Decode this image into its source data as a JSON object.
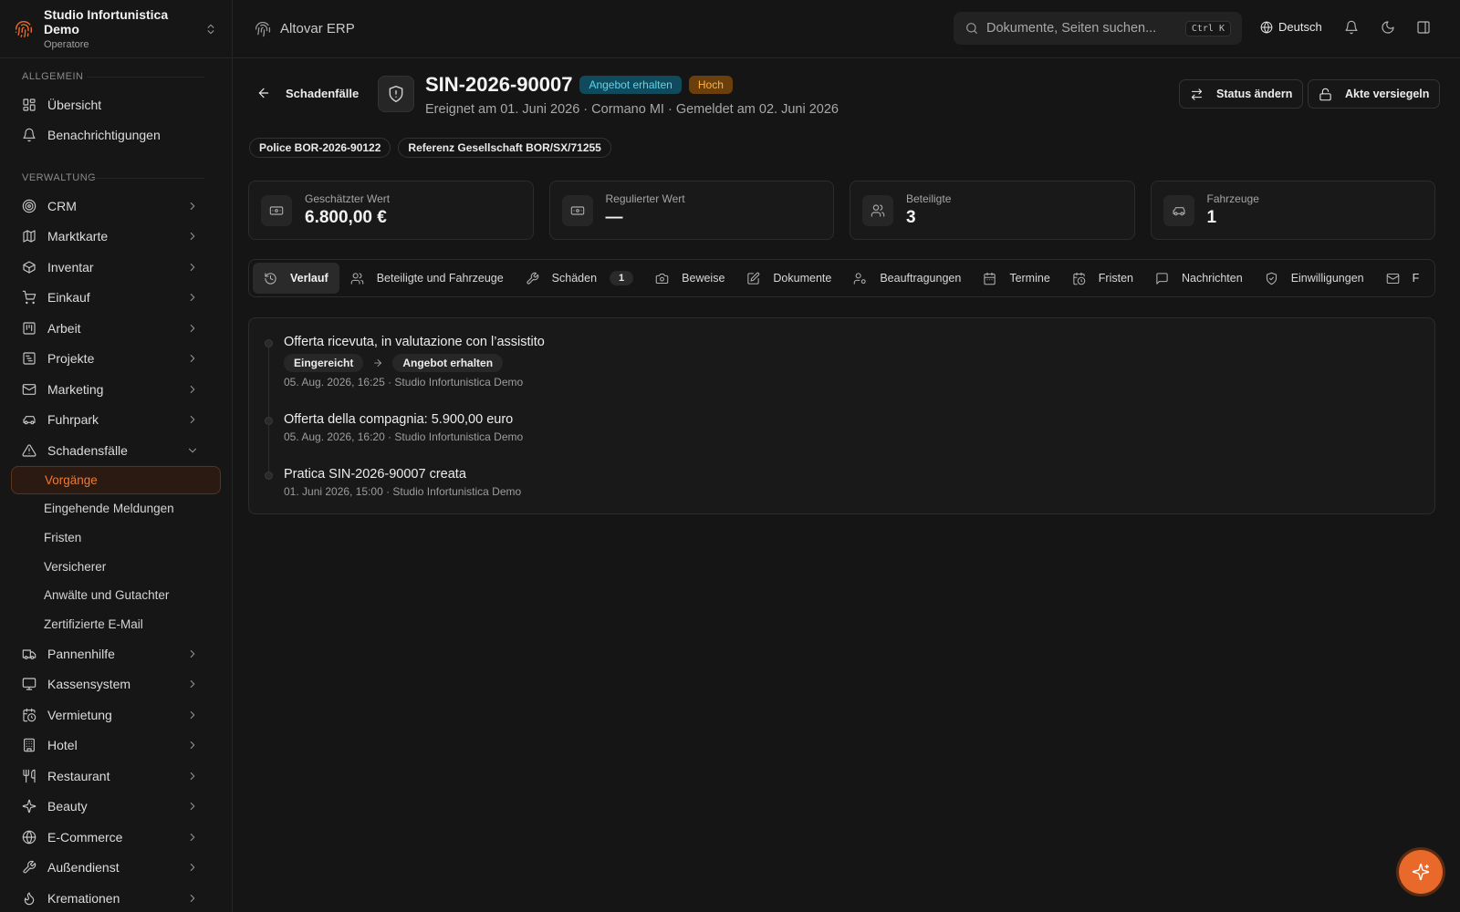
{
  "org": {
    "name": "Studio Infortunistica Demo",
    "role": "Operatore"
  },
  "sidebar": {
    "sections": [
      {
        "label": "Allgemein"
      },
      {
        "label": "Verwaltung"
      }
    ],
    "general": [
      {
        "label": "Übersicht",
        "icon": "dashboard-icon"
      },
      {
        "label": "Benachrichtigungen",
        "icon": "bell-icon"
      }
    ],
    "admin": [
      {
        "label": "CRM",
        "icon": "target-icon"
      },
      {
        "label": "Marktkarte",
        "icon": "map-icon"
      },
      {
        "label": "Inventar",
        "icon": "box-icon"
      },
      {
        "label": "Einkauf",
        "icon": "cart-icon"
      },
      {
        "label": "Arbeit",
        "icon": "kanban-icon"
      },
      {
        "label": "Projekte",
        "icon": "chart-icon"
      },
      {
        "label": "Marketing",
        "icon": "mail-icon"
      },
      {
        "label": "Fuhrpark",
        "icon": "car-icon"
      },
      {
        "label": "Schadensfälle",
        "icon": "warning-icon"
      }
    ],
    "claims_sub": [
      {
        "label": "Vorgänge",
        "active": true
      },
      {
        "label": "Eingehende Meldungen"
      },
      {
        "label": "Fristen"
      },
      {
        "label": "Versicherer"
      },
      {
        "label": "Anwälte und Gutachter"
      },
      {
        "label": "Zertifizierte E-Mail"
      }
    ],
    "more": [
      {
        "label": "Pannenhilfe",
        "icon": "truck-icon"
      },
      {
        "label": "Kassensystem",
        "icon": "monitor-icon"
      },
      {
        "label": "Vermietung",
        "icon": "calendar-clock-icon"
      },
      {
        "label": "Hotel",
        "icon": "building-icon"
      },
      {
        "label": "Restaurant",
        "icon": "utensils-icon"
      },
      {
        "label": "Beauty",
        "icon": "sparkles-icon"
      },
      {
        "label": "E-Commerce",
        "icon": "globe-icon"
      },
      {
        "label": "Außendienst",
        "icon": "wrench-icon"
      },
      {
        "label": "Kremationen",
        "icon": "flame-icon"
      }
    ]
  },
  "topbar": {
    "app_name": "Altovar ERP",
    "search_placeholder": "Dokumente, Seiten suchen...",
    "shortcut": "Ctrl K",
    "language": "Deutsch"
  },
  "claim": {
    "back_label": "Schadenfälle",
    "id": "SIN-2026-90007",
    "status": "Angebot erhalten",
    "priority": "Hoch",
    "subtitle": "Ereignet am 01. Juni 2026 · Cormano MI · Gemeldet am 02. Juni 2026",
    "actions": {
      "change_status": "Status ändern",
      "seal": "Akte versiegeln"
    },
    "chips": {
      "policy": "Police BOR-2026-90122",
      "reference": "Referenz Gesellschaft BOR/SX/71255"
    }
  },
  "stats": [
    {
      "label": "Geschätzter Wert",
      "value": "6.800,00 €",
      "icon": "banknote-icon"
    },
    {
      "label": "Regulierter Wert",
      "value": "—",
      "icon": "banknote-icon"
    },
    {
      "label": "Beteiligte",
      "value": "3",
      "icon": "users-icon"
    },
    {
      "label": "Fahrzeuge",
      "value": "1",
      "icon": "car-icon"
    }
  ],
  "tabs": [
    {
      "label": "Verlauf",
      "active": true
    },
    {
      "label": "Beteiligte und Fahrzeuge"
    },
    {
      "label": "Schäden",
      "count": "1"
    },
    {
      "label": "Beweise"
    },
    {
      "label": "Dokumente"
    },
    {
      "label": "Beauftragungen"
    },
    {
      "label": "Termine"
    },
    {
      "label": "Fristen"
    },
    {
      "label": "Nachrichten"
    },
    {
      "label": "Einwilligungen"
    },
    {
      "label": "F"
    }
  ],
  "timeline": [
    {
      "title": "Offerta ricevuta, in valutazione con l’assistito",
      "from": "Eingereicht",
      "to": "Angebot erhalten",
      "meta": "05. Aug. 2026, 16:25 · Studio Infortunistica Demo"
    },
    {
      "title": "Offerta della compagnia: 5.900,00 euro",
      "meta": "05. Aug. 2026, 16:20 · Studio Infortunistica Demo"
    },
    {
      "title": "Pratica SIN-2026-90007 creata",
      "meta": "01. Juni 2026, 15:00 · Studio Infortunistica Demo"
    }
  ],
  "colors": {
    "accent": "#e8692a",
    "status_bg": "#0f4b5c",
    "status_fg": "#5fd3ee",
    "priority_bg": "#6b3f0b",
    "priority_fg": "#ffb347"
  }
}
